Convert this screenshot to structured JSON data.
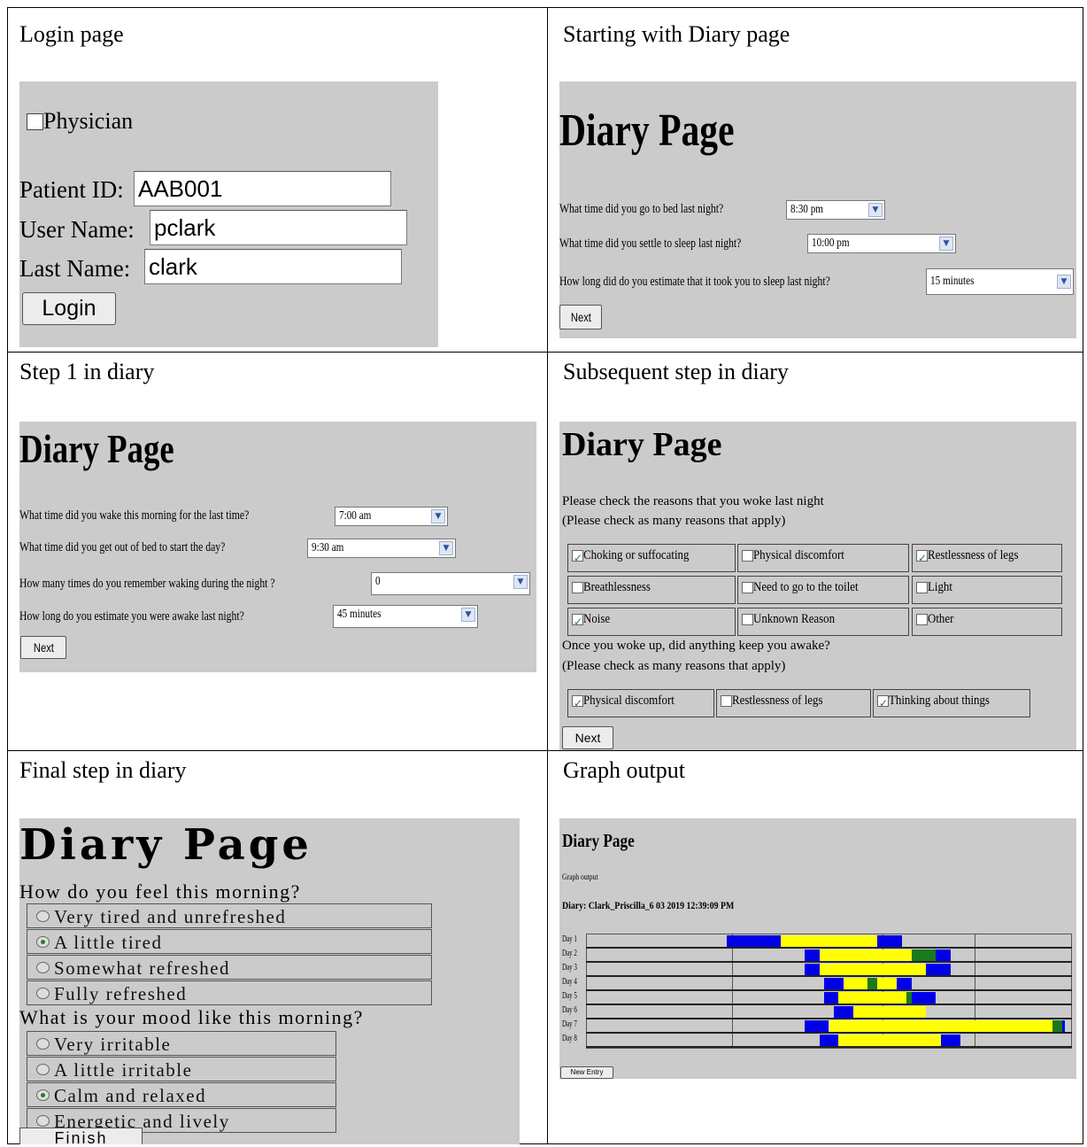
{
  "cells": {
    "login_title": "Login page",
    "diary_start_title": "Starting with Diary page",
    "step1_title": "Step 1 in diary",
    "subsequent_title": "Subsequent step in diary",
    "final_title": "Final step in diary",
    "graph_title": "Graph output"
  },
  "login": {
    "physician_label": "Physician",
    "patient_id_label": "Patient ID:",
    "patient_id_value": "AAB001",
    "user_name_label": "User Name:",
    "user_name_value": "pclark",
    "last_name_label": "Last Name:",
    "last_name_value": "clark",
    "login_button": "Login"
  },
  "diary_start": {
    "heading": "Diary Page",
    "q1": "What time did you go to bed last night?",
    "a1": "8:30 pm",
    "q2": "What time did you settle to sleep last night?",
    "a2": "10:00 pm",
    "q3": "How long did do you estimate that it took you to sleep last night?",
    "a3": "15 minutes",
    "next": "Next"
  },
  "step1": {
    "heading": "Diary Page",
    "q1": "What time did you wake this morning for the last time?",
    "a1": "7:00 am",
    "q2": "What time did you get out of bed to start the day?",
    "a2": "9:30 am",
    "q3": "How many times do you remember waking during the night ?",
    "a3": "0",
    "q4": "How long do you estimate you were awake last night?",
    "a4": "45 minutes",
    "next": "Next"
  },
  "subsequent": {
    "heading": "Diary Page",
    "intro1": "Please check the reasons that you woke last night",
    "intro2": "(Please check as many reasons that apply)",
    "reasons": [
      {
        "label": "Choking or suffocating",
        "checked": true
      },
      {
        "label": "Physical discomfort",
        "checked": false
      },
      {
        "label": "Restlessness of legs",
        "checked": true
      },
      {
        "label": "Breathlessness",
        "checked": false
      },
      {
        "label": "Need to go to the toilet",
        "checked": false
      },
      {
        "label": "Light",
        "checked": false
      },
      {
        "label": "Noise",
        "checked": true
      },
      {
        "label": "Unknown Reason",
        "checked": false
      },
      {
        "label": "Other",
        "checked": false
      }
    ],
    "intro3": "Once you woke up, did anything keep you awake?",
    "intro4": "(Please check as many reasons that apply)",
    "awake": [
      {
        "label": "Physical discomfort",
        "checked": true
      },
      {
        "label": "Restlessness of legs",
        "checked": false
      },
      {
        "label": "Thinking about things",
        "checked": true
      }
    ],
    "next": "Next"
  },
  "final": {
    "heading": "Diary Page",
    "q1": "How do you feel this morning?",
    "feel": [
      {
        "label": "Very tired and unrefreshed",
        "selected": false
      },
      {
        "label": "A little tired",
        "selected": true
      },
      {
        "label": "Somewhat refreshed",
        "selected": false
      },
      {
        "label": "Fully refreshed",
        "selected": false
      }
    ],
    "q2": "What is your mood like this morning?",
    "mood": [
      {
        "label": "Very irritable",
        "selected": false
      },
      {
        "label": "A little irritable",
        "selected": false
      },
      {
        "label": "Calm and relaxed",
        "selected": true
      },
      {
        "label": "Energetic and lively",
        "selected": false
      }
    ],
    "finish": "Finish"
  },
  "graph": {
    "heading": "Diary Page",
    "subtitle": "Graph output",
    "diary_line": "Diary: Clark_Priscilla_6 03 2019 12:39:09 PM",
    "new_entry": "New Entry",
    "colors": {
      "blue": "#0000e8",
      "yellow": "#ffff00",
      "green": "#1a7a1a"
    }
  },
  "chart_data": {
    "type": "bar",
    "categories": [
      "Day 1",
      "Day 2",
      "Day 3",
      "Day 4",
      "Day 5",
      "Day 6",
      "Day 7",
      "Day 8"
    ],
    "x_units": "fraction of chart width",
    "series": [
      {
        "segments": [
          [
            "blue",
            0.29,
            0.4
          ],
          [
            "yellow",
            0.4,
            0.6
          ],
          [
            "blue",
            0.6,
            0.65
          ]
        ]
      },
      {
        "segments": [
          [
            "blue",
            0.45,
            0.48
          ],
          [
            "yellow",
            0.48,
            0.67
          ],
          [
            "green",
            0.67,
            0.72
          ],
          [
            "blue",
            0.72,
            0.75
          ]
        ]
      },
      {
        "segments": [
          [
            "blue",
            0.45,
            0.48
          ],
          [
            "yellow",
            0.48,
            0.7
          ],
          [
            "blue",
            0.7,
            0.75
          ]
        ]
      },
      {
        "segments": [
          [
            "blue",
            0.49,
            0.53
          ],
          [
            "yellow",
            0.53,
            0.58
          ],
          [
            "green",
            0.58,
            0.6
          ],
          [
            "yellow",
            0.6,
            0.64
          ],
          [
            "blue",
            0.64,
            0.67
          ]
        ]
      },
      {
        "segments": [
          [
            "blue",
            0.49,
            0.52
          ],
          [
            "yellow",
            0.52,
            0.66
          ],
          [
            "green",
            0.66,
            0.67
          ],
          [
            "blue",
            0.67,
            0.72
          ]
        ]
      },
      {
        "segments": [
          [
            "blue",
            0.51,
            0.55
          ],
          [
            "yellow",
            0.55,
            0.7
          ]
        ]
      },
      {
        "segments": [
          [
            "blue",
            0.45,
            0.5
          ],
          [
            "yellow",
            0.5,
            0.96
          ],
          [
            "green",
            0.96,
            0.98
          ],
          [
            "blue",
            0.98,
            0.985
          ]
        ]
      },
      {
        "segments": [
          [
            "blue",
            0.48,
            0.52
          ],
          [
            "yellow",
            0.52,
            0.73
          ],
          [
            "blue",
            0.73,
            0.77
          ]
        ]
      }
    ]
  }
}
